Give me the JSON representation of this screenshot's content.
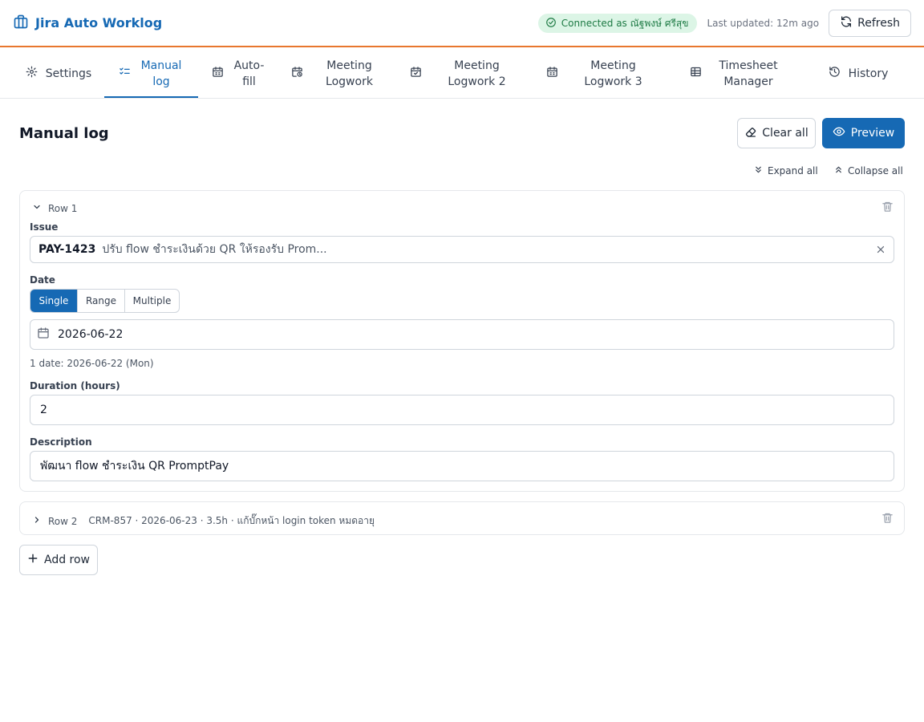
{
  "app": {
    "title": "Jira Auto Worklog",
    "brand_icon": "briefcase-icon",
    "accent_color": "#1669b4",
    "header_border_color": "#e8772e"
  },
  "header": {
    "connection_status": "Connected as ณัฐพงษ์ ศรีสุข",
    "last_updated": "Last updated: 12m ago",
    "refresh_label": "Refresh"
  },
  "tabs": [
    {
      "label": "Settings",
      "icon": "gear-icon",
      "active": false
    },
    {
      "label": "Manual log",
      "icon": "checklist-icon",
      "active": true
    },
    {
      "label": "Auto-fill",
      "icon": "calendar-icon",
      "active": false
    },
    {
      "label": "Meeting Logwork",
      "icon": "calendar-clock-icon",
      "active": false
    },
    {
      "label": "Meeting Logwork 2",
      "icon": "calendar-check-icon",
      "active": false
    },
    {
      "label": "Meeting Logwork 3",
      "icon": "calendar-icon",
      "active": false
    },
    {
      "label": "Timesheet Manager",
      "icon": "table-icon",
      "active": false
    },
    {
      "label": "History",
      "icon": "history-icon",
      "active": false
    }
  ],
  "page": {
    "title": "Manual log",
    "clear_all_label": "Clear all",
    "preview_label": "Preview",
    "expand_all_label": "Expand all",
    "collapse_all_label": "Collapse all"
  },
  "rows": [
    {
      "label": "Row 1",
      "issue_label": "Issue",
      "issue_key": "PAY-1423",
      "issue_summary": "ปรับ flow ชำระเงินด้วย QR ให้รองรับ Prom...",
      "date_label": "Date",
      "date_modes": [
        "Single",
        "Range",
        "Multiple"
      ],
      "date_mode_selected": "Single",
      "date_value": "2026-06-22",
      "date_hint": "1 date: 2026-06-22 (Mon)",
      "duration_label": "Duration (hours)",
      "duration_value": "2",
      "description_label": "Description",
      "description_value": "พัฒนา flow ชำระเงิน QR PromptPay"
    },
    {
      "label": "Row 2",
      "summary": "CRM-857 · 2026-06-23 · 3.5h · แก้บั๊กหน้า login token หมดอายุ"
    }
  ],
  "add_row_label": "Add row"
}
